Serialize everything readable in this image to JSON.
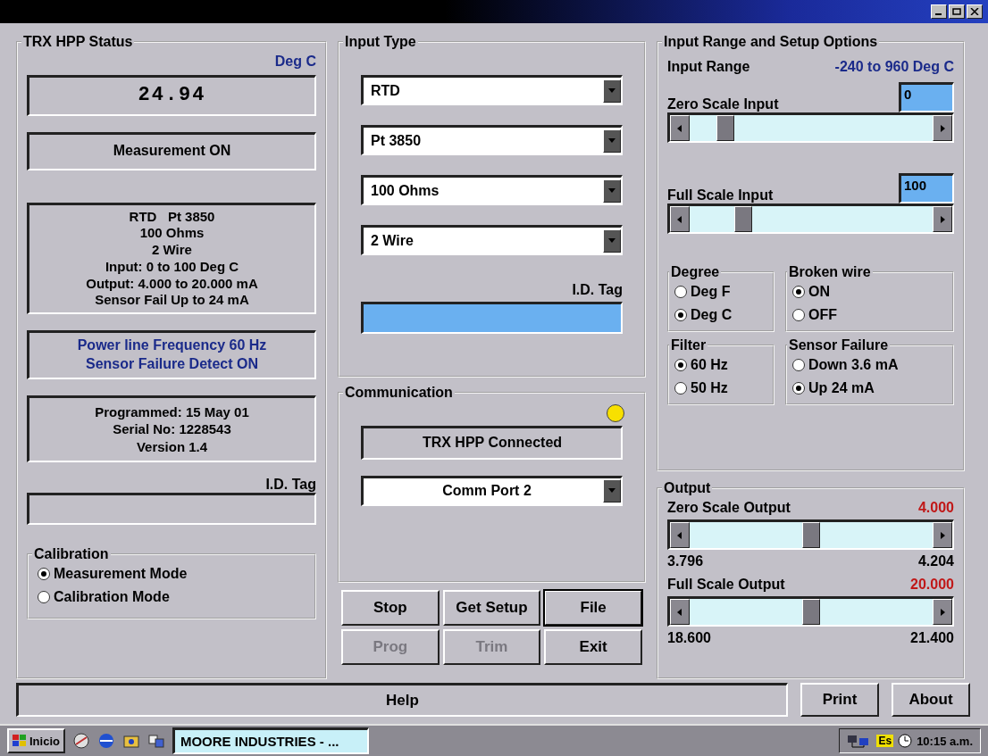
{
  "status": {
    "title": "TRX HPP Status",
    "unit": "Deg C",
    "reading": "24.94",
    "measurement": "Measurement ON",
    "summary": [
      "RTD   Pt 3850",
      "100 Ohms",
      "2 Wire",
      "Input: 0 to 100 Deg C",
      "Output: 4.000 to 20.000 mA",
      "Sensor Fail Up to 24 mA"
    ],
    "notes": [
      "Power line Frequency 60 Hz",
      "Sensor Failure Detect ON"
    ],
    "info": [
      "Programmed: 15 May 01",
      "Serial No: 1228543",
      "Version 1.4"
    ],
    "id_tag_label": "I.D. Tag",
    "calibration": {
      "title": "Calibration",
      "options": [
        {
          "label": "Measurement Mode",
          "selected": true
        },
        {
          "label": "Calibration Mode",
          "selected": false
        }
      ]
    }
  },
  "input_type": {
    "title": "Input Type",
    "selects": [
      "RTD",
      "Pt 3850",
      "100 Ohms",
      "2 Wire"
    ],
    "id_tag_label": "I.D. Tag"
  },
  "communication": {
    "title": "Communication",
    "indicator_on": true,
    "status": "TRX HPP Connected",
    "port": "Comm Port 2"
  },
  "buttons": [
    {
      "label": "Stop",
      "disabled": false,
      "focused": false
    },
    {
      "label": "Get Setup",
      "disabled": false,
      "focused": false
    },
    {
      "label": "File",
      "disabled": false,
      "focused": true
    },
    {
      "label": "Prog",
      "disabled": true,
      "focused": false
    },
    {
      "label": "Trim",
      "disabled": true,
      "focused": false
    },
    {
      "label": "Exit",
      "disabled": false,
      "focused": false
    }
  ],
  "setup": {
    "title": "Input Range and Setup Options",
    "range_label": "Input Range",
    "range_value": "-240 to 960 Deg C",
    "scales": [
      {
        "label": "Zero Scale Input",
        "value": "0",
        "level": 0.12
      },
      {
        "label": "Full Scale Input",
        "value": "100",
        "level": 0.2
      }
    ],
    "groups": [
      {
        "title": "Degree",
        "options": [
          {
            "label": "Deg F",
            "selected": false
          },
          {
            "label": "Deg C",
            "selected": true
          }
        ]
      },
      {
        "title": "Broken wire",
        "options": [
          {
            "label": "ON",
            "selected": true
          },
          {
            "label": "OFF",
            "selected": false
          }
        ]
      },
      {
        "title": "Filter",
        "options": [
          {
            "label": "60 Hz",
            "selected": true
          },
          {
            "label": "50 Hz",
            "selected": false
          }
        ]
      },
      {
        "title": "Sensor Failure",
        "options": [
          {
            "label": "Down 3.6 mA",
            "selected": false
          },
          {
            "label": "Up 24 mA",
            "selected": true
          }
        ]
      }
    ]
  },
  "output": {
    "title": "Output",
    "sliders": [
      {
        "label": "Zero Scale Output",
        "value": "4.000",
        "level": 0.5,
        "min": "3.796",
        "max": "4.204"
      },
      {
        "label": "Full Scale Output",
        "value": "20.000",
        "level": 0.5,
        "min": "18.600",
        "max": "21.400"
      }
    ]
  },
  "help": "Help",
  "footer_buttons": [
    "Print",
    "About"
  ],
  "taskbar": {
    "start": "Inicio",
    "task": "MOORE INDUSTRIES - ...",
    "language": "Es",
    "clock": "10:15 a.m."
  }
}
